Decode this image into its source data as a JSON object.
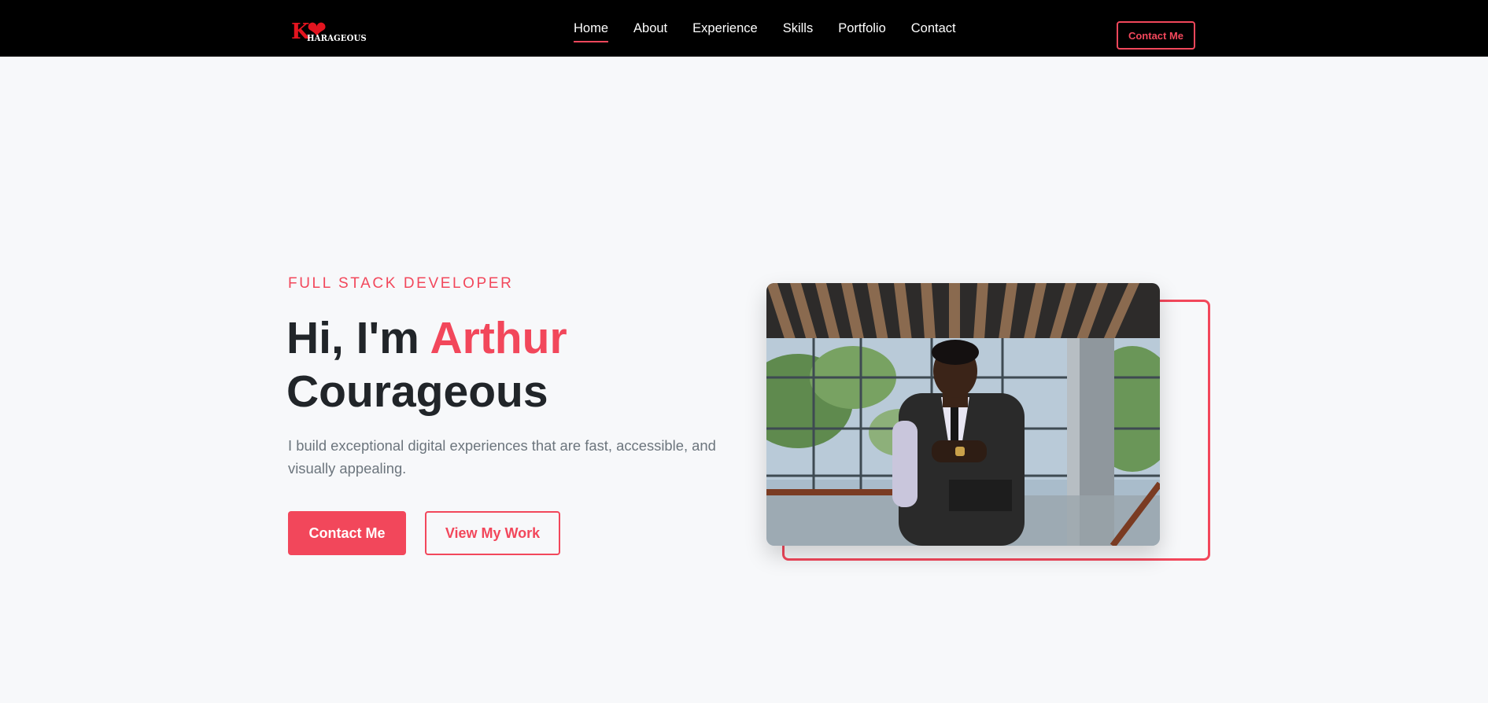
{
  "logo": {
    "initial": "K",
    "text": "HARAGEOUS"
  },
  "nav": {
    "items": [
      {
        "label": "Home"
      },
      {
        "label": "About"
      },
      {
        "label": "Experience"
      },
      {
        "label": "Skills"
      },
      {
        "label": "Portfolio"
      },
      {
        "label": "Contact"
      }
    ],
    "active": "Home",
    "cta_label": "Contact Me"
  },
  "hero": {
    "subtitle": "FULL STACK DEVELOPER",
    "greeting": "Hi, I'm",
    "first_name": "Arthur",
    "last_name": "Courageous",
    "description": "I build exceptional digital experiences that are fast, accessible, and visually appealing.",
    "primary_button": "Contact Me",
    "secondary_button": "View My Work"
  },
  "colors": {
    "accent": "#f2475b",
    "navbar": "#000000",
    "background": "#f7f8fa",
    "heading": "#212529",
    "muted": "#6c757d"
  }
}
